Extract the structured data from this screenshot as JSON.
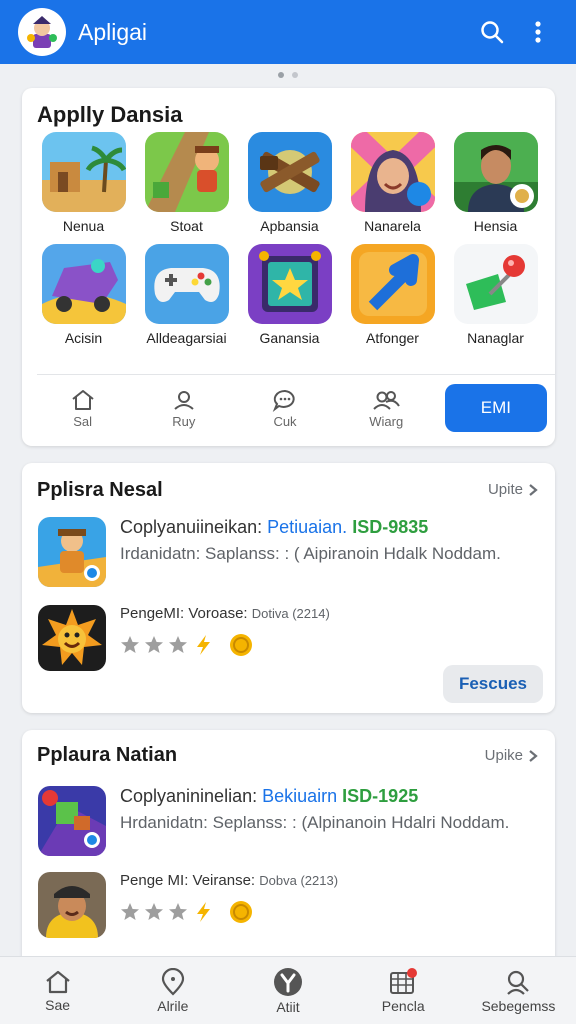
{
  "app_bar": {
    "title": "Apligai"
  },
  "featured": {
    "title": "Applly Dansia",
    "apps": [
      {
        "label": "Nenua",
        "icon": "desert-landscape-icon"
      },
      {
        "label": "Stoat",
        "icon": "adventure-runner-icon"
      },
      {
        "label": "Apbansia",
        "icon": "hammer-tools-icon"
      },
      {
        "label": "Nanarela",
        "icon": "hooded-girl-icon"
      },
      {
        "label": "Hensia",
        "icon": "man-portrait-icon"
      },
      {
        "label": "Acisin",
        "icon": "racing-car-icon"
      },
      {
        "label": "Alldeagarsiai",
        "icon": "game-controller-icon"
      },
      {
        "label": "Ganansia",
        "icon": "star-tablet-icon"
      },
      {
        "label": "Atfonger",
        "icon": "blue-arrow-icon"
      },
      {
        "label": "Nanaglar",
        "icon": "map-pin-icon"
      }
    ],
    "tabs": [
      {
        "label": "Sal",
        "icon": "home-icon"
      },
      {
        "label": "Ruy",
        "icon": "person-icon"
      },
      {
        "label": "Cuk",
        "icon": "chat-bubble-icon"
      },
      {
        "label": "Wiarg",
        "icon": "people-icon"
      }
    ],
    "cta_label": "EMI"
  },
  "section1": {
    "title": "Pplisra Nesal",
    "more_label": "Upite",
    "item1": {
      "name": "Coplyanuiineikan:",
      "accent": "Petiuaian.",
      "code": "ISD-9835",
      "desc": "Irdanidatn: Saplanss: : ( Aipiranoin Hdalk Noddam."
    },
    "item2": {
      "name": "PengeMI: Voroase:",
      "meta": "Dotiva (2214)"
    },
    "cta_label": "Fescues"
  },
  "section2": {
    "title": "Pplaura Natian",
    "more_label": "Upike",
    "item1": {
      "name": "Coplyanininelian:",
      "accent": "Bekiuairn",
      "code": "ISD-1925",
      "desc": "Hrdanidatn: Seplanss: : (Alpinanoin Hdalri Noddam."
    },
    "item2": {
      "name": "Penge MI: Veiranse:",
      "meta": "Dobva (2213)"
    }
  },
  "bottom_nav": [
    {
      "label": "Sae",
      "icon": "home-icon"
    },
    {
      "label": "Alrile",
      "icon": "location-pin-icon"
    },
    {
      "label": "Atiit",
      "icon": "y-badge-icon"
    },
    {
      "label": "Pencla",
      "icon": "calendar-grid-icon"
    },
    {
      "label": "Sebegemss",
      "icon": "profile-search-icon"
    }
  ],
  "colors": {
    "primary": "#1a73e8",
    "accent_green": "#2e9e3f",
    "star": "#9e9e9e",
    "badge_red": "#e53935"
  }
}
